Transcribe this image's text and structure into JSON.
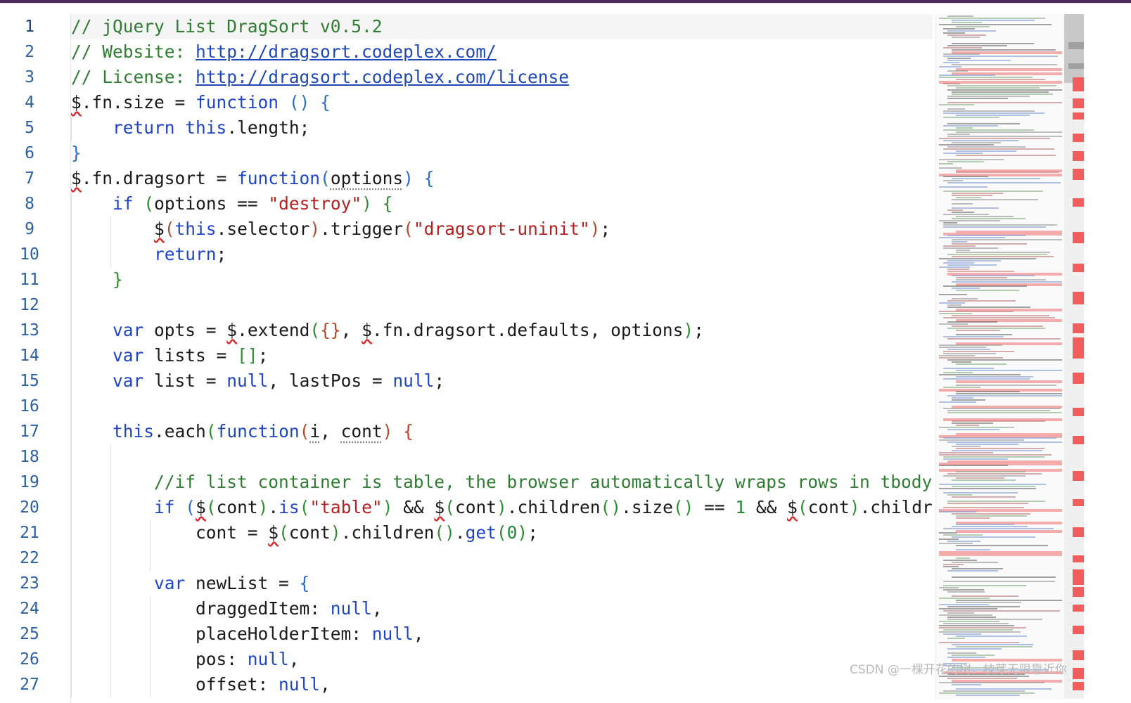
{
  "editor": {
    "current_line": 1,
    "line_numbers": [
      "1",
      "2",
      "3",
      "4",
      "5",
      "6",
      "7",
      "8",
      "9",
      "10",
      "11",
      "12",
      "13",
      "14",
      "15",
      "16",
      "17",
      "18",
      "19",
      "20",
      "21",
      "22",
      "23",
      "24",
      "25",
      "26",
      "27"
    ]
  },
  "code": {
    "l1": "// jQuery List DragSort v0.5.2",
    "l2_prefix": "// Website: ",
    "l2_url": "http://dragsort.codeplex.com/",
    "l3_prefix": "// License: ",
    "l3_url": "http://dragsort.codeplex.com/license",
    "l19": "//if list container is table, the browser automatically wraps rows in tbody if"
  },
  "watermark": "CSDN @一棵开花的树，枝芽无限靠近你",
  "colors": {
    "comment": "#2f7d32",
    "keyword": "#1f45c7",
    "string": "#b51f1f",
    "line_number": "#2b5fa3",
    "error_marker": "#f25e5e",
    "title_bar": "#4b2a5e"
  }
}
